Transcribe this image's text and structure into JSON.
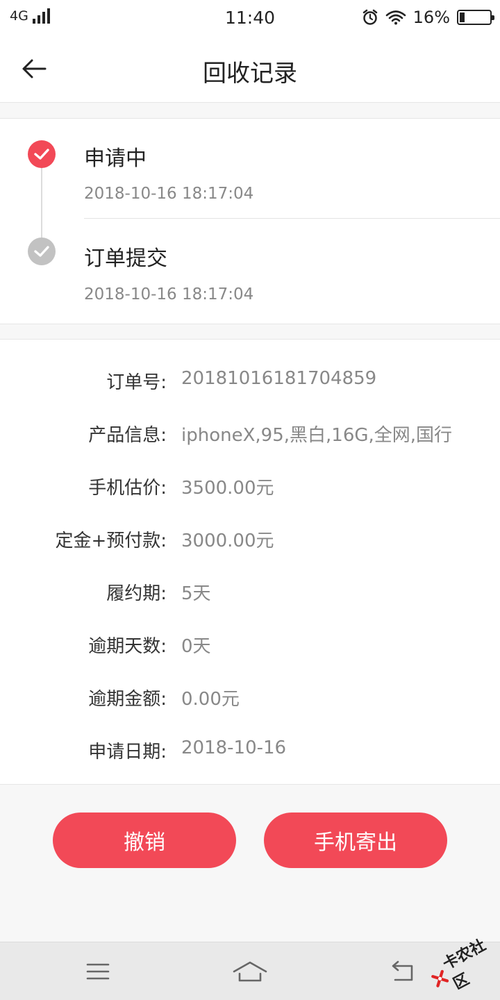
{
  "status_bar": {
    "network": "4G",
    "time": "11:40",
    "battery": "16%",
    "battery_level": 0.16
  },
  "header": {
    "title": "回收记录"
  },
  "timeline": [
    {
      "title": "申请中",
      "time": "2018-10-16 18:17:04",
      "state": "active"
    },
    {
      "title": "订单提交",
      "time": "2018-10-16 18:17:04",
      "state": "done"
    }
  ],
  "details": [
    {
      "label": "订单号:",
      "value": "20181016181704859"
    },
    {
      "label": "产品信息:",
      "value": "iphoneX,95,黑白,16G,全网,国行"
    },
    {
      "label": "手机估价:",
      "value": "3500.00元"
    },
    {
      "label": "定金+预付款:",
      "value": "3000.00元"
    },
    {
      "label": "履约期:",
      "value": "5天"
    },
    {
      "label": "逾期天数:",
      "value": "0天"
    },
    {
      "label": "逾期金额:",
      "value": "0.00元"
    },
    {
      "label": "申请日期:",
      "value": "2018-10-16"
    }
  ],
  "actions": {
    "cancel_label": "撤销",
    "ship_label": "手机寄出"
  },
  "watermark": {
    "text": "卡农社区"
  },
  "colors": {
    "accent": "#f24957",
    "done_gray": "#c2c2c2"
  }
}
